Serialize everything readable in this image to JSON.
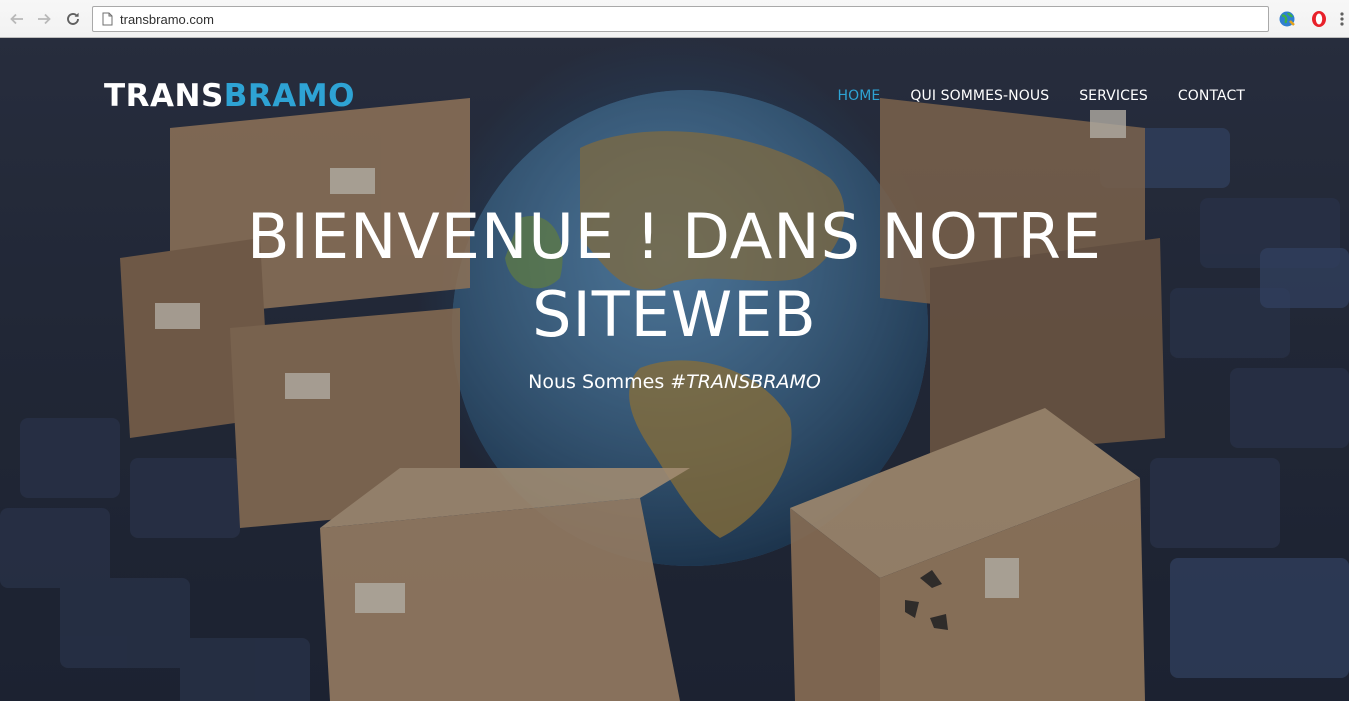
{
  "browser": {
    "url": "transbramo.com"
  },
  "site": {
    "logo_primary": "TRANS",
    "logo_accent": "BRAMO",
    "accent_color": "#2ea3d4",
    "nav": [
      {
        "label": "HOME",
        "active": true
      },
      {
        "label": "QUI SOMMES-NOUS",
        "active": false
      },
      {
        "label": "SERVICES",
        "active": false
      },
      {
        "label": "CONTACT",
        "active": false
      }
    ]
  },
  "hero": {
    "title_line1": "BIENVENUE ! DANS NOTRE",
    "title_line2": "SITEWEB",
    "subtitle_prefix": "Nous Sommes ",
    "subtitle_tag": "#TRANSBRAMO"
  }
}
